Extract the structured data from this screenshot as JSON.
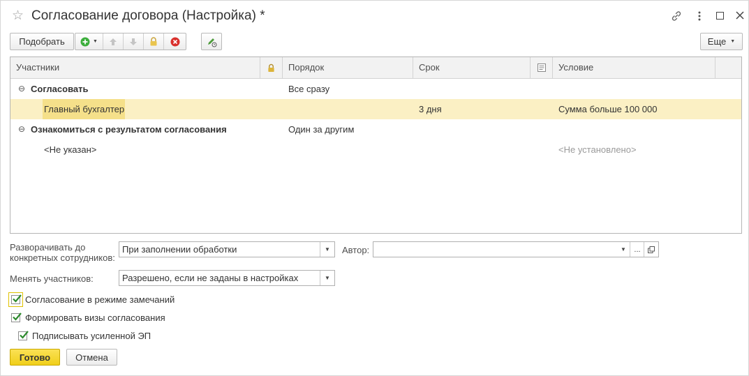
{
  "window": {
    "title": "Согласование договора (Настройка) *"
  },
  "toolbar": {
    "pick_label": "Подобрать",
    "more_label": "Еще"
  },
  "table": {
    "columns": [
      "Участники",
      "Порядок",
      "Срок",
      "Условие"
    ],
    "groups": [
      {
        "name": "Согласовать",
        "order": "Все сразу",
        "member": {
          "name": "Главный бухгалтер",
          "term": "3 дня",
          "condition": "Сумма больше 100 000"
        }
      },
      {
        "name": "Ознакомиться с результатом согласования",
        "order": "Один за другим",
        "member": {
          "name": "<Не указан>",
          "term": "",
          "condition": "<Не установлено>"
        }
      }
    ]
  },
  "form": {
    "expand_label_line1": "Разворачивать до",
    "expand_label_line2": "конкретных сотрудников:",
    "expand_value": "При заполнении обработки",
    "author_label": "Автор:",
    "author_value": "",
    "author_ellipsis": "...",
    "change_label": "Менять участников:",
    "change_value": "Разрешено, если не заданы в настройках",
    "checkboxes": [
      {
        "label": "Согласование в режиме замечаний",
        "checked": true
      },
      {
        "label": "Формировать визы согласования",
        "checked": true
      },
      {
        "label": "Подписывать усиленной ЭП",
        "checked": true
      }
    ]
  },
  "footer": {
    "ok_label": "Готово",
    "cancel_label": "Отмена"
  },
  "colors": {
    "accent_yellow": "#f5d527",
    "selected_row": "#fbf0c4",
    "selected_cell": "#f5e08a",
    "green_add": "#3cae3c",
    "red_delete": "#d9302c"
  }
}
